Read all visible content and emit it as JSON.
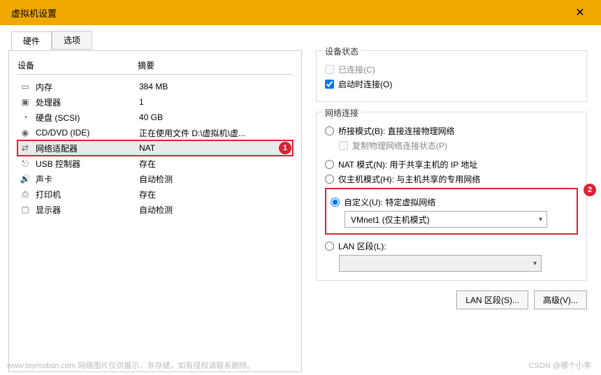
{
  "window": {
    "title": "虚拟机设置",
    "close": "✕"
  },
  "tabs": {
    "hardware": "硬件",
    "options": "选项"
  },
  "table": {
    "headers": {
      "device": "设备",
      "summary": "摘要"
    },
    "rows": [
      {
        "icon": "memory",
        "name": "内存",
        "summary": "384 MB"
      },
      {
        "icon": "cpu",
        "name": "处理器",
        "summary": "1"
      },
      {
        "icon": "disk",
        "name": "硬盘 (SCSI)",
        "summary": "40 GB"
      },
      {
        "icon": "cd",
        "name": "CD/DVD (IDE)",
        "summary": "正在使用文件 D:\\虚拟机\\虚..."
      },
      {
        "icon": "net",
        "name": "网络适配器",
        "summary": "NAT",
        "selected": true,
        "callout": "1"
      },
      {
        "icon": "usb",
        "name": "USB 控制器",
        "summary": "存在"
      },
      {
        "icon": "sound",
        "name": "声卡",
        "summary": "自动检测"
      },
      {
        "icon": "printer",
        "name": "打印机",
        "summary": "存在"
      },
      {
        "icon": "display",
        "name": "显示器",
        "summary": "自动检测"
      }
    ]
  },
  "status": {
    "title": "设备状态",
    "connected": "已连接(C)",
    "connect_power": "启动时连接(O)"
  },
  "network": {
    "title": "网络连接",
    "bridged": "桥接模式(B): 直接连接物理网络",
    "replicate": "复制物理网络连接状态(P)",
    "nat": "NAT 模式(N): 用于共享主机的 IP 地址",
    "hostonly": "仅主机模式(H): 与主机共享的专用网络",
    "custom": "自定义(U): 特定虚拟网络",
    "custom_value": "VMnet1 (仅主机模式)",
    "lan": "LAN 区段(L):",
    "callout2": "2"
  },
  "buttons": {
    "lan_segment": "LAN 区段(S)...",
    "advanced": "高级(V)..."
  },
  "watermark": {
    "left": "www.toymoban.com  网络图片仅供展示，非存储，如有侵权请联系删除。",
    "right": "CSDN @哪个小李"
  }
}
